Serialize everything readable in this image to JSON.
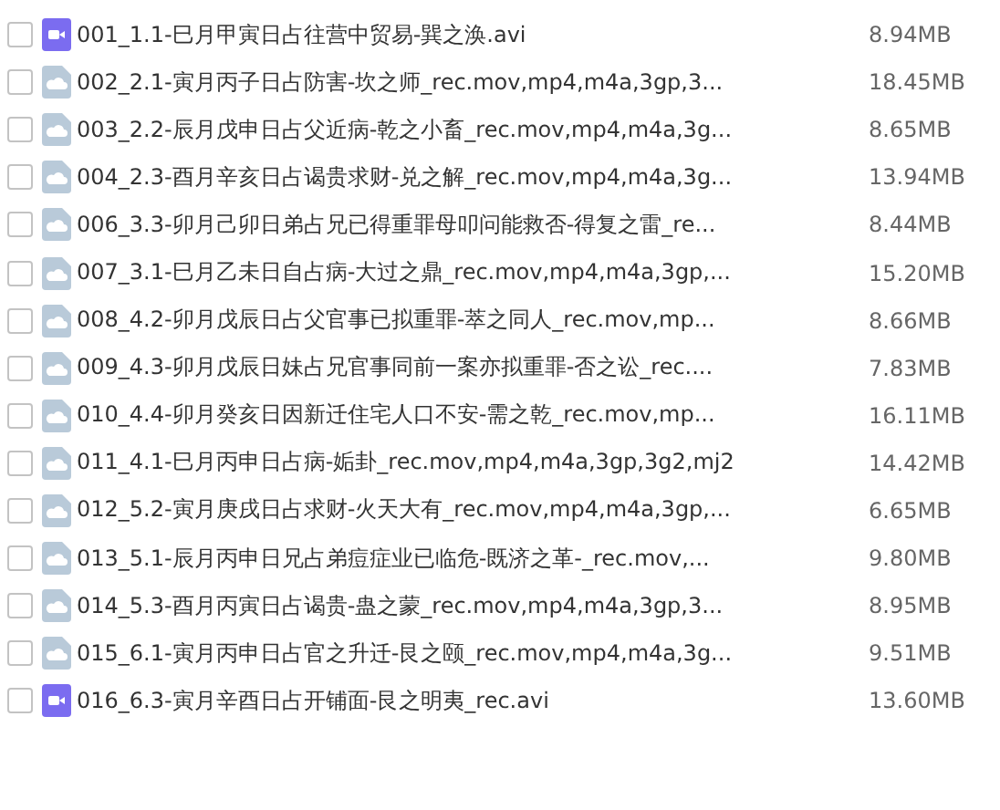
{
  "files": [
    {
      "kind": "video",
      "checked": false,
      "name": "001_1.1-巳月甲寅日占往营中贸易-巽之涣.avi",
      "size": "8.94MB"
    },
    {
      "kind": "file",
      "checked": false,
      "name": "002_2.1-寅月丙子日占防害-坎之师_rec.mov,mp4,m4a,3gp,3...",
      "size": "18.45MB"
    },
    {
      "kind": "file",
      "checked": false,
      "name": "003_2.2-辰月戊申日占父近病-乾之小畜_rec.mov,mp4,m4a,3g...",
      "size": "8.65MB"
    },
    {
      "kind": "file",
      "checked": false,
      "name": "004_2.3-酉月辛亥日占谒贵求财-兑之解_rec.mov,mp4,m4a,3g...",
      "size": "13.94MB"
    },
    {
      "kind": "file",
      "checked": false,
      "name": "006_3.3-卯月己卯日弟占兄已得重罪母叩问能救否-得复之雷_re...",
      "size": "8.44MB"
    },
    {
      "kind": "file",
      "checked": false,
      "name": "007_3.1-巳月乙未日自占病-大过之鼎_rec.mov,mp4,m4a,3gp,...",
      "size": "15.20MB"
    },
    {
      "kind": "file",
      "checked": false,
      "name": "008_4.2-卯月戊辰日占父官事已拟重罪-萃之同人_rec.mov,mp...",
      "size": "8.66MB"
    },
    {
      "kind": "file",
      "checked": false,
      "name": "009_4.3-卯月戊辰日妹占兄官事同前一案亦拟重罪-否之讼_rec....",
      "size": "7.83MB"
    },
    {
      "kind": "file",
      "checked": false,
      "name": "010_4.4-卯月癸亥日因新迁住宅人口不安-需之乾_rec.mov,mp...",
      "size": "16.11MB"
    },
    {
      "kind": "file",
      "checked": false,
      "name": "011_4.1-巳月丙申日占病-姤卦_rec.mov,mp4,m4a,3gp,3g2,mj2",
      "size": "14.42MB"
    },
    {
      "kind": "file",
      "checked": false,
      "name": "012_5.2-寅月庚戌日占求财-火天大有_rec.mov,mp4,m4a,3gp,...",
      "size": "6.65MB"
    },
    {
      "kind": "file",
      "checked": false,
      "name": "013_5.1-辰月丙申日兄占弟痘症业已临危-既济之革-_rec.mov,...",
      "size": "9.80MB"
    },
    {
      "kind": "file",
      "checked": false,
      "name": "014_5.3-酉月丙寅日占谒贵-蛊之蒙_rec.mov,mp4,m4a,3gp,3...",
      "size": "8.95MB"
    },
    {
      "kind": "file",
      "checked": false,
      "name": "015_6.1-寅月丙申日占官之升迁-艮之颐_rec.mov,mp4,m4a,3g...",
      "size": "9.51MB"
    },
    {
      "kind": "video",
      "checked": false,
      "name": "016_6.3-寅月辛酉日占开铺面-艮之明夷_rec.avi",
      "size": "13.60MB"
    }
  ]
}
